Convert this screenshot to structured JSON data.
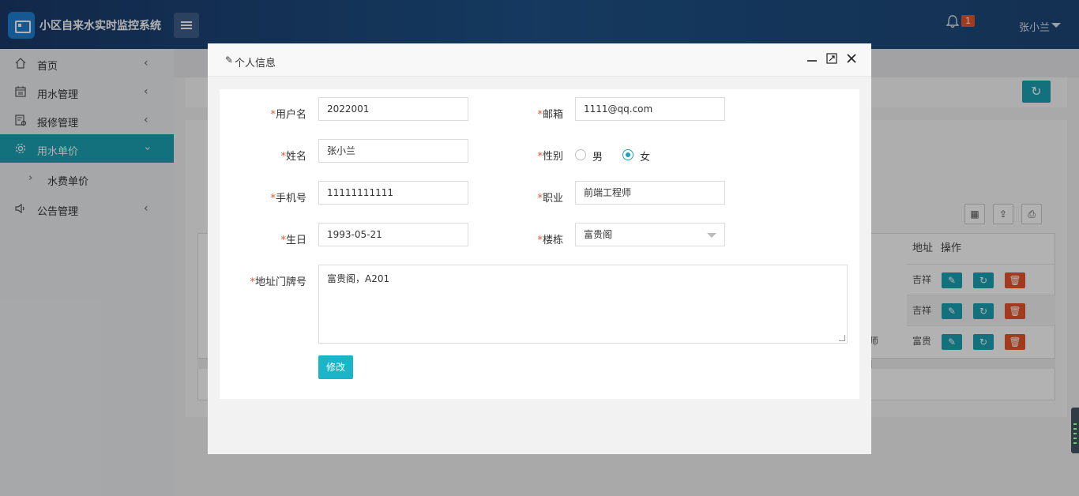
{
  "header": {
    "app_title": "小区自来水实时监控系统",
    "notification_count": "1",
    "user_name": "张小兰"
  },
  "sidebar": {
    "items": [
      {
        "label": "首页",
        "icon": "home-icon"
      },
      {
        "label": "用水管理",
        "icon": "calendar-icon"
      },
      {
        "label": "报修管理",
        "icon": "repair-icon"
      },
      {
        "label": "用水单价",
        "icon": "gear-icon",
        "active": true
      },
      {
        "label": "公告管理",
        "icon": "speaker-icon"
      }
    ],
    "sub_items": [
      {
        "label": "水费单价"
      }
    ]
  },
  "background": {
    "table_headers": [
      "地址",
      "操作"
    ],
    "rows": [
      {
        "address": "吉祥"
      },
      {
        "address": "吉祥"
      },
      {
        "address": "富贵",
        "prefix": "师"
      }
    ]
  },
  "modal": {
    "title": "个人信息",
    "fields": {
      "username": {
        "label": "用户名",
        "value": "2022001"
      },
      "email": {
        "label": "邮箱",
        "value": "1111@qq.com"
      },
      "name": {
        "label": "姓名",
        "value": "张小兰"
      },
      "gender": {
        "label": "性别",
        "options": [
          "男",
          "女"
        ],
        "selected": "女"
      },
      "phone": {
        "label": "手机号",
        "value": "11111111111"
      },
      "job": {
        "label": "职业",
        "value": "前端工程师"
      },
      "birthday": {
        "label": "生日",
        "value": "1993-05-21"
      },
      "building": {
        "label": "楼栋",
        "value": "富贵阁"
      },
      "address": {
        "label": "地址门牌号",
        "value": "富贵阁，A201"
      }
    },
    "submit_label": "修改"
  },
  "colors": {
    "accent": "#1ba2b3",
    "danger": "#e8552b",
    "header": "#1f5288"
  }
}
